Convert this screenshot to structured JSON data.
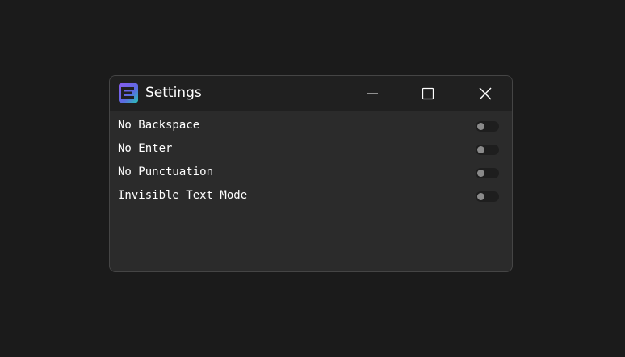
{
  "window": {
    "title": "Settings",
    "icon": "app-logo-icon",
    "controls": [
      "minimize-icon",
      "maximize-icon",
      "close-icon"
    ]
  },
  "settings": [
    {
      "label": "No Backspace",
      "enabled": false
    },
    {
      "label": "No Enter",
      "enabled": false
    },
    {
      "label": "No Punctuation",
      "enabled": false
    },
    {
      "label": "Invisible Text Mode",
      "enabled": false
    }
  ],
  "colors": {
    "background": "#1b1b1b",
    "window_body": "#2b2b2b",
    "titlebar": "#202020",
    "text": "#ffffff",
    "toggle_track": "#1e1e1e",
    "toggle_knob": "#8a8a8a",
    "logo_purple": "#7b5cd6",
    "logo_teal": "#27c4b5"
  }
}
